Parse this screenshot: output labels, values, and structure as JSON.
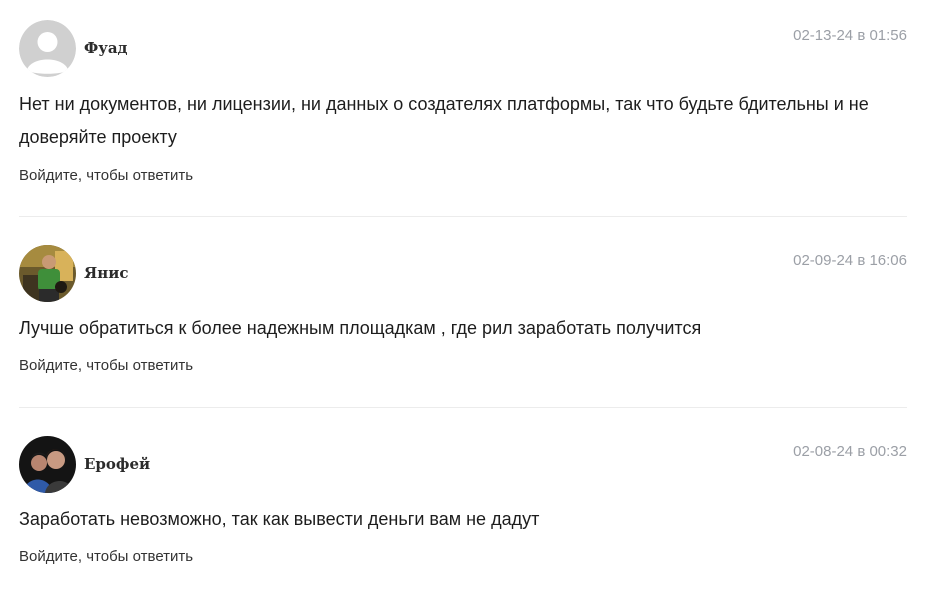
{
  "comments": [
    {
      "author": "Фуад",
      "date": "02-13-24 в 01:56",
      "text": "Нет ни документов, ни лицензии, ни данных о создателях платформы, так что будьте бдительны и не доверяйте проекту",
      "reply_label": "Войдите, чтобы ответить",
      "avatar_icon": "default-user-avatar"
    },
    {
      "author": "Янис",
      "date": "02-09-24 в 16:06",
      "text": "Лучше обратиться к более надежным площадкам , где рил заработать получится",
      "reply_label": "Войдите, чтобы ответить",
      "avatar_icon": "user-photo-avatar"
    },
    {
      "author": "Ерофей",
      "date": "02-08-24 в 00:32",
      "text": "Заработать невозможно, так как вывести деньги вам не дадут",
      "reply_label": "Войдите, чтобы ответить",
      "avatar_icon": "user-photo-avatar"
    }
  ],
  "colors": {
    "text": "#1d1d1d",
    "date": "#9b9fa6",
    "divider": "#ececec",
    "default_avatar_bg": "#d0d0d0"
  }
}
